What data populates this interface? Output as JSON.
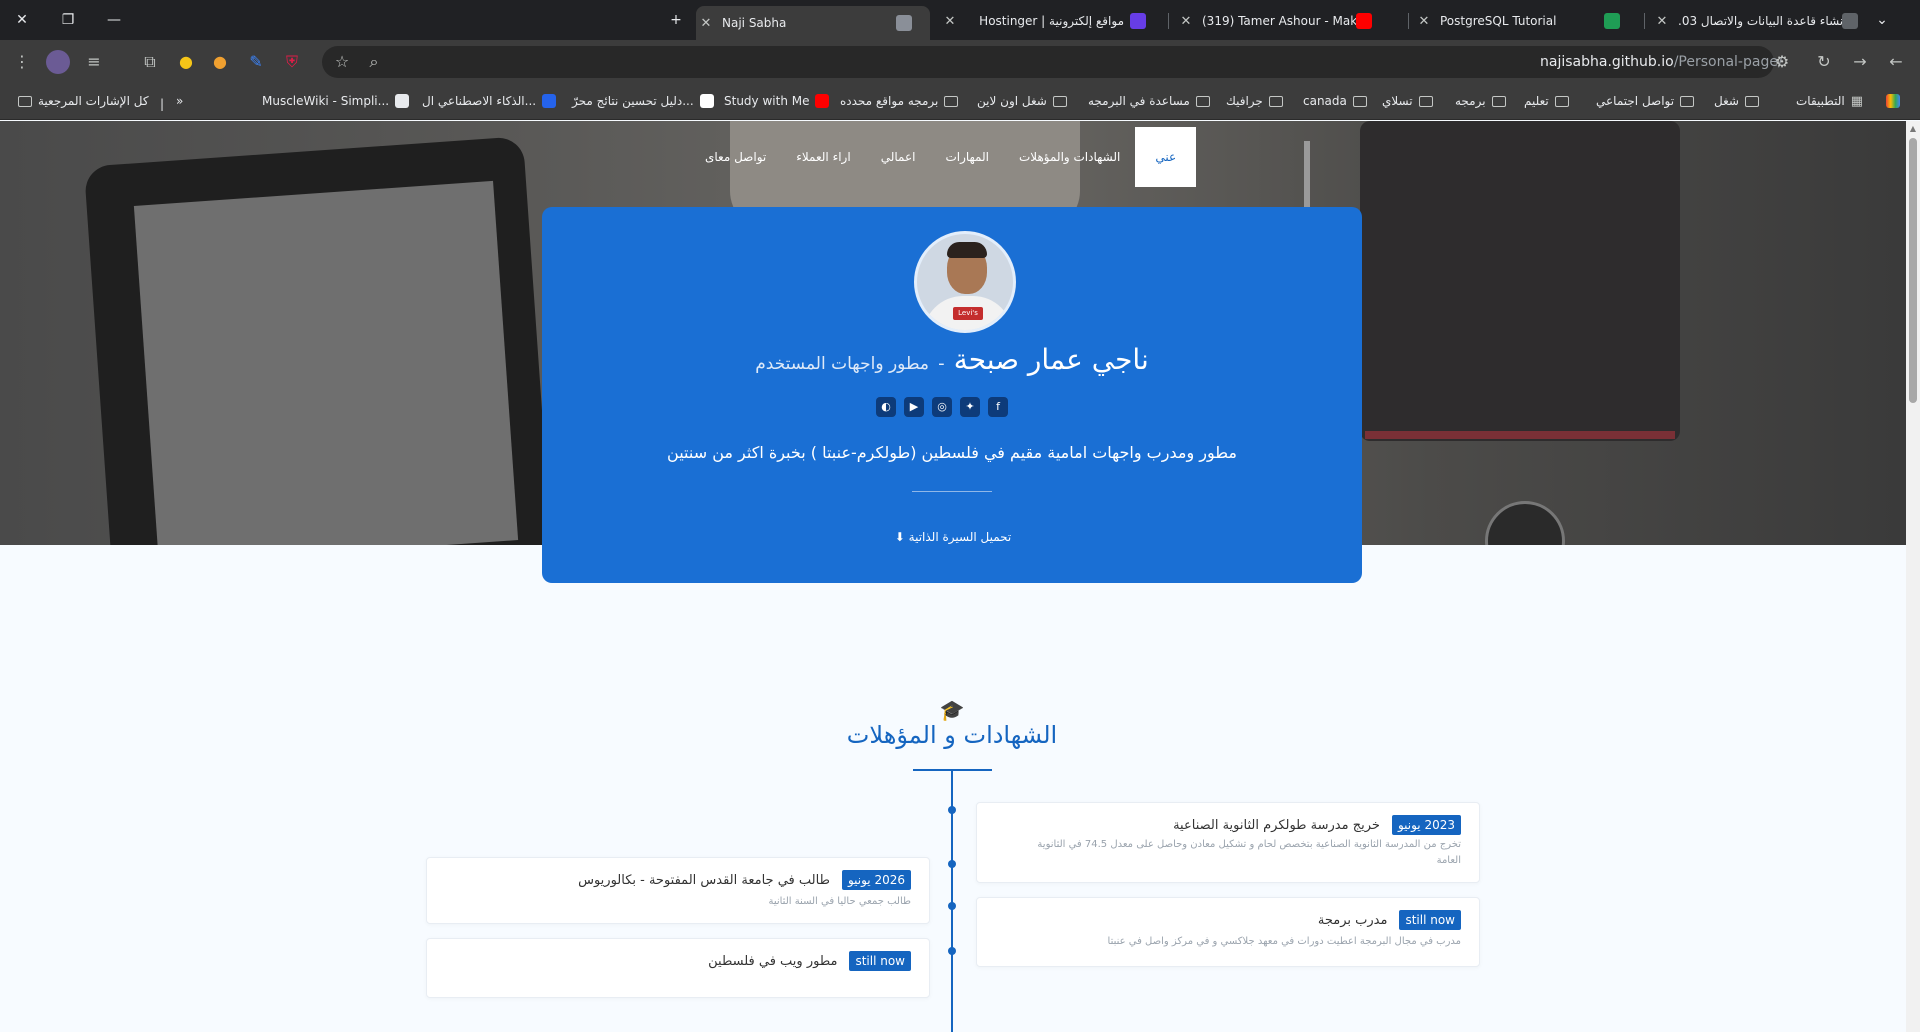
{
  "browser": {
    "tabs": [
      {
        "title": ".03 إنشاء قاعدة البيانات والاتصال",
        "active": false
      },
      {
        "title": "PostgreSQL Tutorial",
        "active": false
      },
      {
        "title": "(319) Tamer Ashour - Makr",
        "active": false
      },
      {
        "title": "Hostinger | مواقع إلكترونية",
        "active": false
      },
      {
        "title": "Naji Sabha",
        "active": true
      }
    ],
    "new_tab_label": "+",
    "url_host": "najisabha.github.io",
    "url_path": "/Personal-page/",
    "bookmarks": [
      {
        "label": "التطبيقات",
        "icon": "apps-grid-icon"
      },
      {
        "label": "شغل",
        "icon": "folder-icon"
      },
      {
        "label": "تواصل اجتماعي",
        "icon": "folder-icon"
      },
      {
        "label": "تعليم",
        "icon": "folder-icon"
      },
      {
        "label": "برمجه",
        "icon": "folder-icon"
      },
      {
        "label": "تسلاي",
        "icon": "folder-icon"
      },
      {
        "label": "canada",
        "icon": "folder-icon"
      },
      {
        "label": "جرافيك",
        "icon": "folder-icon"
      },
      {
        "label": "مساعدة في البرمجه",
        "icon": "folder-icon"
      },
      {
        "label": "شغل اون لاين",
        "icon": "folder-icon"
      },
      {
        "label": "برمجه مواقع محدده",
        "icon": "folder-icon"
      },
      {
        "label": "Study with Me",
        "icon": "youtube-icon"
      },
      {
        "label": "دليل تحسين نتائج محرّ...",
        "icon": "google-icon"
      },
      {
        "label": "الذكاء الاصطناعي ال...",
        "icon": "c-icon"
      },
      {
        "label": "MuscleWiki - Simpli...",
        "icon": "musclewiki-icon"
      }
    ],
    "bookmarks_overflow": "»",
    "all_bookmarks_label": "كل الإشارات المرجعية"
  },
  "nav": {
    "items": [
      "عني",
      "الشهادات والمؤهلات",
      "المهارات",
      "اعمالي",
      "اراء العملاء",
      "تواصل معاى"
    ],
    "active_index": 0
  },
  "profile": {
    "name": "ناجي عمار صبحة",
    "separator": "-",
    "role": "مطور واجهات المستخدم",
    "bio": "مطور ومدرب واجهات امامية مقيم في فلسطين (طولكرم-عنبتا ) بخبرة اكثر من سنتين",
    "cv_button": "تحميل السيرة الذاتية",
    "socials": [
      "github-icon",
      "youtube-icon",
      "instagram-icon",
      "twitter-icon",
      "facebook-icon"
    ],
    "avatar_logo_text": "Levi's"
  },
  "certificates": {
    "title": "الشهادات و المؤهلات",
    "right_items": [
      {
        "badge": "2023 يونيو",
        "title": "خريج مدرسة طولكرم الثانوية الصناعية",
        "desc_line1": "تخرج من المدرسة الثانوية الصناعية بتخصص لحام و تشكيل معادن وحاصل على معدل 74.5 في الثانوية",
        "desc_line2": "العامة"
      },
      {
        "badge": "still now",
        "title": "مدرب برمجة",
        "desc_line1": "مدرب في مجال البرمجة اعطيت دورات في معهد جلاكسي و في مركز واصل في عنبتا",
        "desc_line2": ""
      }
    ],
    "left_items": [
      {
        "badge": "2026 يونيو",
        "title": "طالب في جامعة القدس المفتوحة - بكالوريوس",
        "desc_line1": "طالب جمعي حاليا في السنة الثانية"
      },
      {
        "badge": "still now",
        "title": "مطور ويب في فلسطين",
        "desc_line1": ""
      }
    ]
  },
  "colors": {
    "brand_blue": "#1565c0",
    "card_blue": "#1a6fd4",
    "chrome_dark": "#202124"
  }
}
